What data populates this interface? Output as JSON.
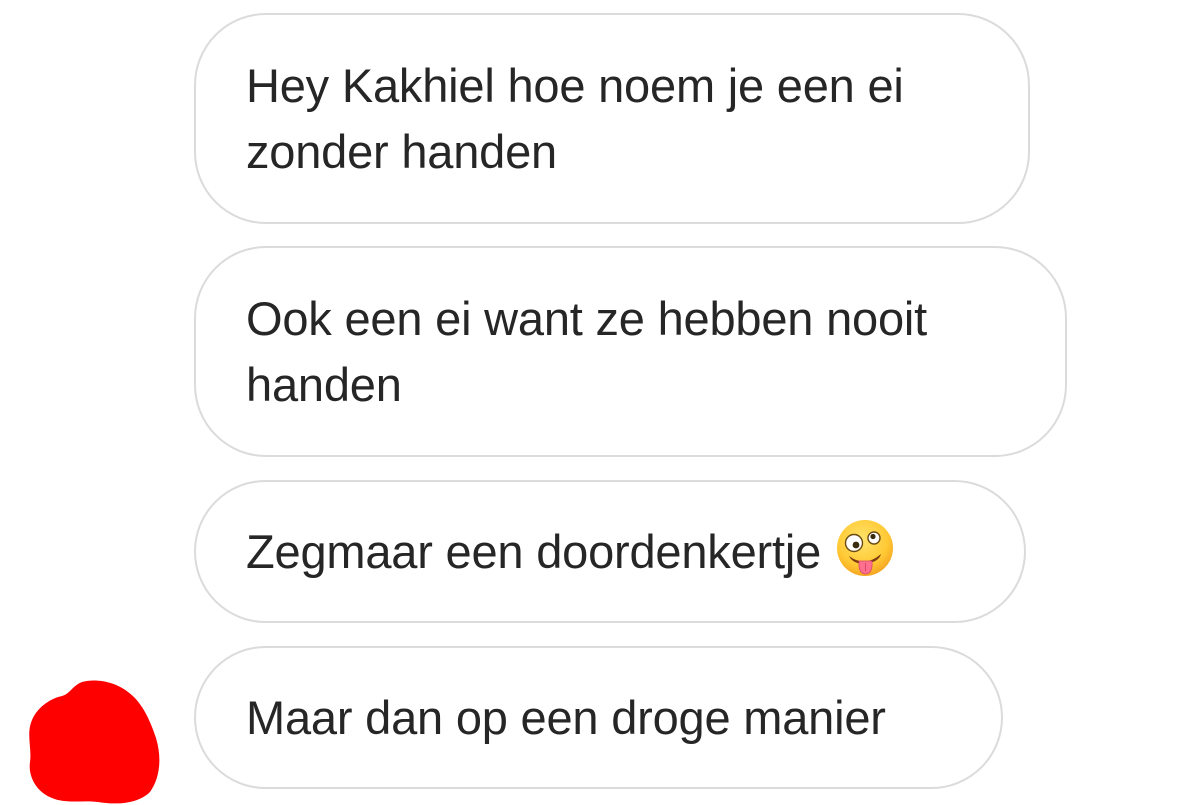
{
  "messages": [
    {
      "text": "Hey Kakhiel hoe noem je een ei zonder handen"
    },
    {
      "text": "Ook een ei want ze hebben nooit handen"
    },
    {
      "text": "Zegmaar een doordenkertje",
      "emoji": "zany-face-icon"
    },
    {
      "text": "Maar dan op een droge manier"
    }
  ],
  "colors": {
    "bubble_border": "#dbdbdb",
    "text": "#262626",
    "scribble": "#ff0000"
  },
  "decorations": {
    "scribble": "red-redaction-scribble"
  }
}
